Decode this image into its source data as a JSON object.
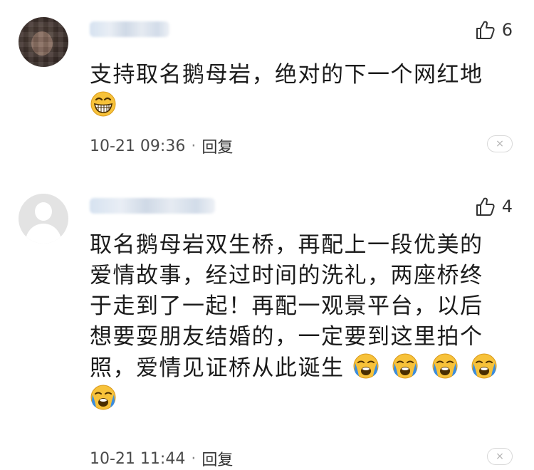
{
  "comments": [
    {
      "likes": "6",
      "lines": [
        "支持取名鹅母岩，绝对的下一个网红地"
      ],
      "time": "10-21 09:36",
      "separator": "·",
      "reply_label": "回复",
      "close_glyph": "×"
    },
    {
      "likes": "4",
      "lines": [
        "取名鹅母岩双生桥，再配上一段优美的",
        "爱情故事，经过时间的洗礼，两座桥终",
        "于走到了一起！再配一观景平台，以后",
        "想要耍朋友结婚的，一定要到这里拍个",
        "照，爱情见证桥从此诞生"
      ],
      "time": "10-21 11:44",
      "separator": "·",
      "reply_label": "回复",
      "close_glyph": "×"
    }
  ],
  "icons": {
    "like": "thumbs-up-icon",
    "grin": "grinning-face-emoji",
    "cry": "crying-face-emoji"
  },
  "colors": {
    "text": "#1b1b1b",
    "meta": "#4a4a4a",
    "emoji_face": "#f7c23a",
    "tears": "#3a8de0"
  }
}
